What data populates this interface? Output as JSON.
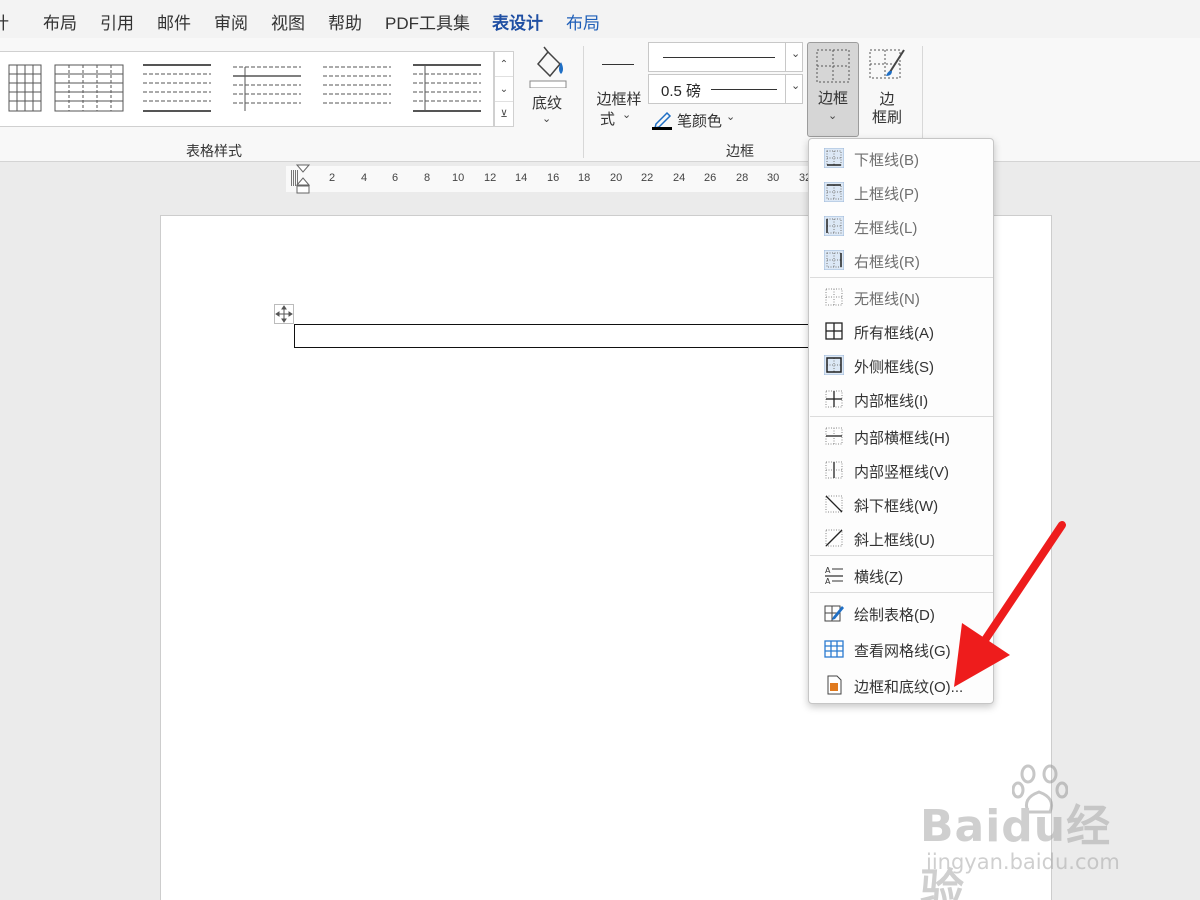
{
  "tabs": [
    {
      "label": "设计",
      "display": "计"
    },
    {
      "label": "布局"
    },
    {
      "label": "引用"
    },
    {
      "label": "邮件"
    },
    {
      "label": "审阅"
    },
    {
      "label": "视图"
    },
    {
      "label": "帮助"
    },
    {
      "label": "PDF工具集"
    },
    {
      "label": "表设计"
    },
    {
      "label": "布局"
    }
  ],
  "ribbon": {
    "table_styles_group": "表格样式",
    "shading": "底纹",
    "border_style_line1": "边框样",
    "border_style_line2": "式",
    "pen_weight": "0.5 磅",
    "pen_color": "笔颜色",
    "borders_group": "边框",
    "borders_button": "边框",
    "border_painter_line1": "边",
    "border_painter_line2": "框刷"
  },
  "ruler": {
    "marks": [
      "2",
      "4",
      "6",
      "8",
      "10",
      "12",
      "14",
      "16",
      "18",
      "20",
      "22",
      "24",
      "26",
      "28",
      "30",
      "32"
    ]
  },
  "menu": {
    "items": [
      {
        "label": "下框线(B)",
        "icon": "bottom-border-icon"
      },
      {
        "label": "上框线(P)",
        "icon": "top-border-icon"
      },
      {
        "label": "左框线(L)",
        "icon": "left-border-icon"
      },
      {
        "label": "右框线(R)",
        "icon": "right-border-icon"
      },
      {
        "label": "无框线(N)",
        "icon": "no-border-icon"
      },
      {
        "label": "所有框线(A)",
        "icon": "all-borders-icon"
      },
      {
        "label": "外侧框线(S)",
        "icon": "outside-borders-icon"
      },
      {
        "label": "内部框线(I)",
        "icon": "inside-borders-icon"
      },
      {
        "label": "内部横框线(H)",
        "icon": "inside-horizontal-border-icon"
      },
      {
        "label": "内部竖框线(V)",
        "icon": "inside-vertical-border-icon"
      },
      {
        "label": "斜下框线(W)",
        "icon": "diagonal-down-border-icon"
      },
      {
        "label": "斜上框线(U)",
        "icon": "diagonal-up-border-icon"
      },
      {
        "label": "横线(Z)",
        "icon": "horizontal-line-icon"
      },
      {
        "label": "绘制表格(D)",
        "icon": "draw-table-icon"
      },
      {
        "label": "查看网格线(G)",
        "icon": "view-gridlines-icon"
      },
      {
        "label": "边框和底纹(O)...",
        "icon": "borders-and-shading-icon"
      }
    ]
  },
  "watermark": {
    "logo": "Baidu经验",
    "url": "jingyan.baidu.com"
  },
  "colors": {
    "accent": "#1f5fb8",
    "arrow": "#ee1c1c"
  }
}
